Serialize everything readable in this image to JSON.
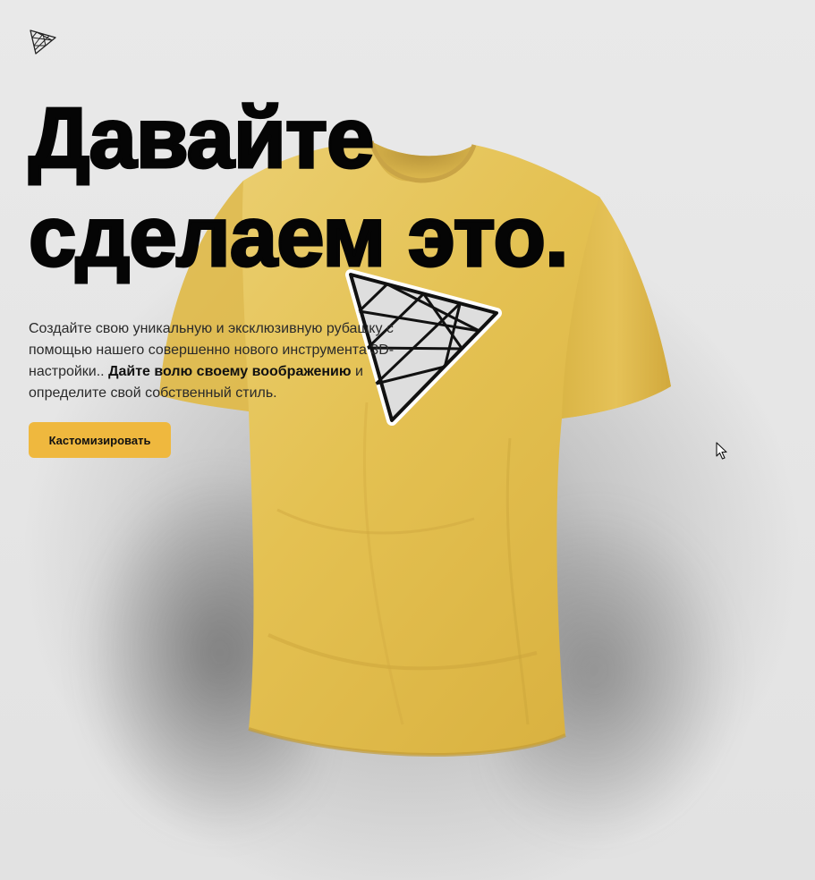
{
  "hero": {
    "headline_line1": "Давайте",
    "headline_line2": "сделаем это.",
    "description_part1": "Создайте свою уникальную и эксклюзивную рубашку с помощью нашего совершенно нового инструмента 3D-настройки.. ",
    "description_bold": "Дайте волю своему воображению",
    "description_part2": " и определите свой собственный стиль.",
    "cta_label": "Кастомизировать"
  },
  "product": {
    "shirt_color": "#e3bd4a",
    "decal_icon": "triangle-grid-logo-icon"
  },
  "colors": {
    "accent": "#efb83e",
    "background": "#e6e6e6",
    "text": "#050505"
  },
  "icons": {
    "logo": "triangle-grid-logo-icon",
    "cursor": "mouse-pointer-icon"
  }
}
